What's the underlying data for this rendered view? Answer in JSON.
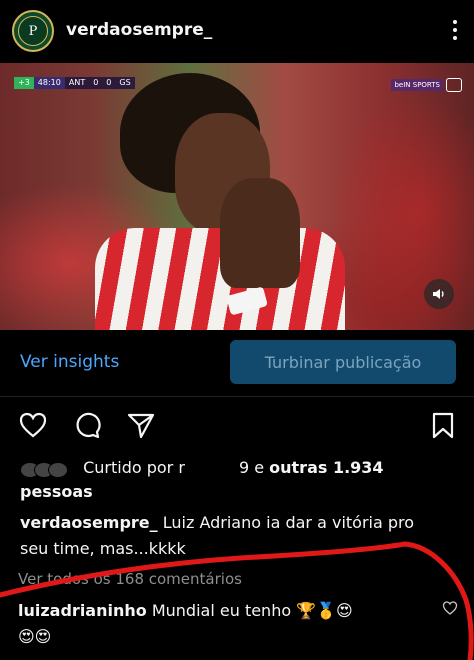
{
  "header": {
    "username": "verdaosempre_",
    "avatar_colors": {
      "bg": "#0d4a2a",
      "ring": "#d7b45a"
    }
  },
  "media": {
    "scorebar": {
      "live": "+3",
      "clock": "48:10",
      "home": "ANT",
      "home_score": "0",
      "away_score": "0",
      "away": "GS"
    },
    "broadcaster": "beIN SPORTS"
  },
  "insights": {
    "link": "Ver insights",
    "boost_button": "Turbinar publicação",
    "link_color": "#4aa8ff"
  },
  "likes": {
    "prefix": "Curtido por",
    "liker_visible_start": "r",
    "liker_visible_end": "9",
    "joiner": " e ",
    "others": "outras 1.934",
    "suffix": "pessoas"
  },
  "caption": {
    "username": "verdaosempre_",
    "text": "Luiz Adriano ia dar a vitória pro",
    "text_line2": "seu time, mas...kkkk"
  },
  "comments": {
    "view_all": "Ver todos os 168 comentários",
    "top": {
      "username": "luizadrianinho",
      "text": "Mundial eu tenho 🏆🥇😍",
      "text_line2": "😍😍"
    }
  },
  "annotation": {
    "color": "#e01818"
  }
}
